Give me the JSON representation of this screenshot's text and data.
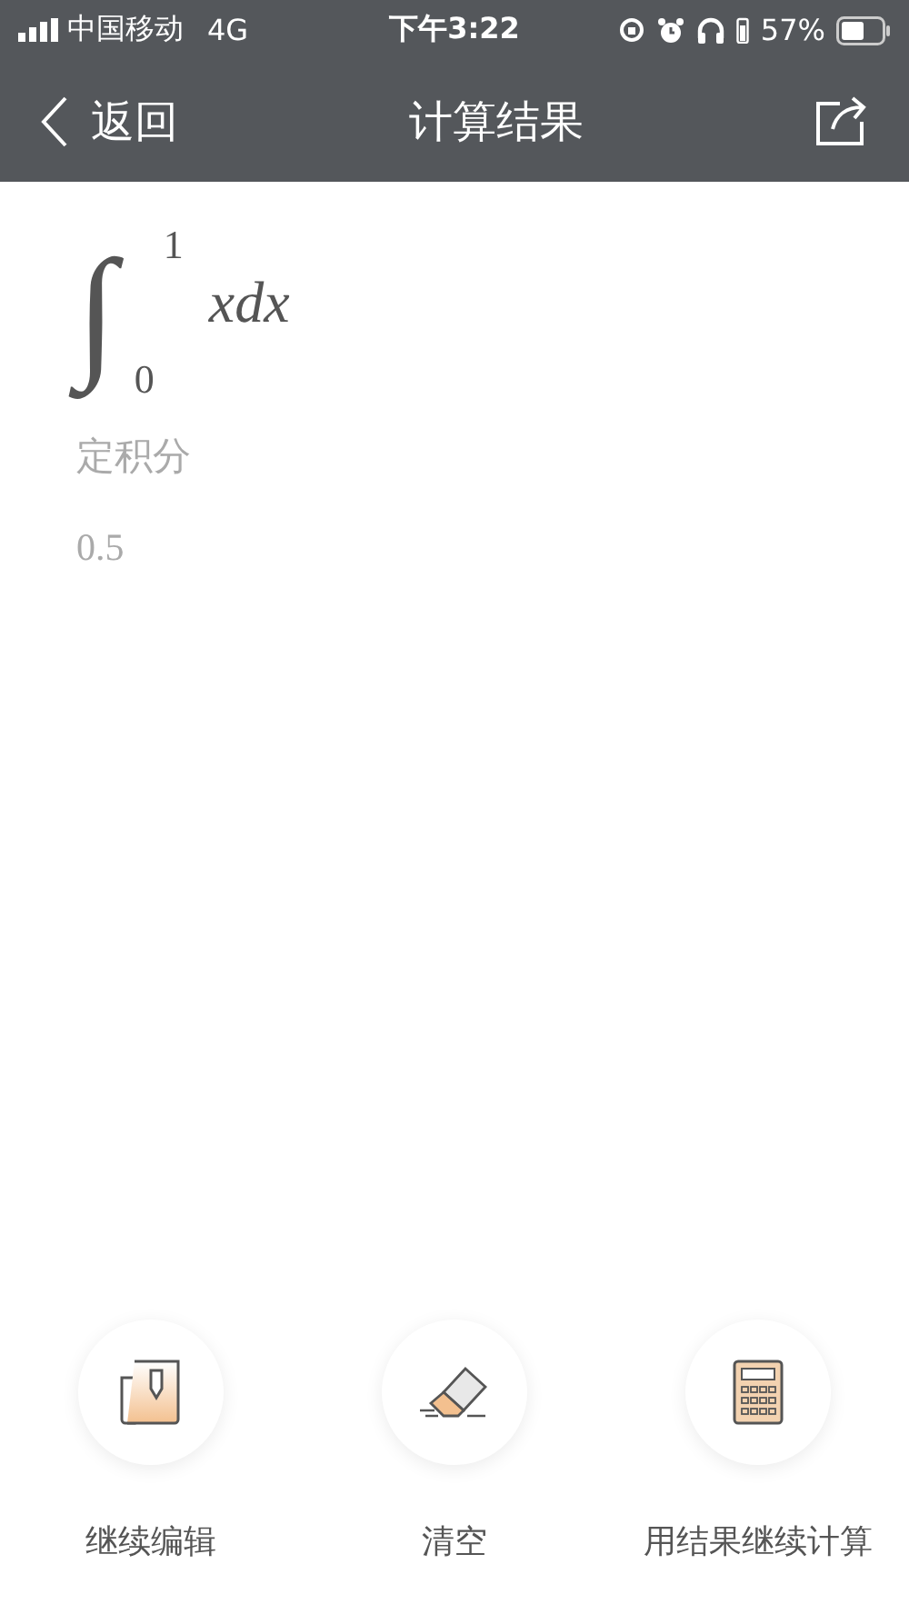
{
  "status_bar": {
    "carrier": "中国移动",
    "network": "4G",
    "time": "下午3:22",
    "battery": "57%"
  },
  "nav_bar": {
    "back": "返回",
    "title": "计算结果"
  },
  "result": {
    "integral_sign": "∫",
    "upper_limit": "1",
    "lower_limit": "0",
    "integrand": "xdx",
    "type_label": "定积分",
    "value": "0.5"
  },
  "actions": [
    {
      "kind": "edit",
      "label": "继续编辑"
    },
    {
      "kind": "clear",
      "label": "清空"
    },
    {
      "kind": "calculator",
      "label": "用结果继续计算"
    }
  ]
}
